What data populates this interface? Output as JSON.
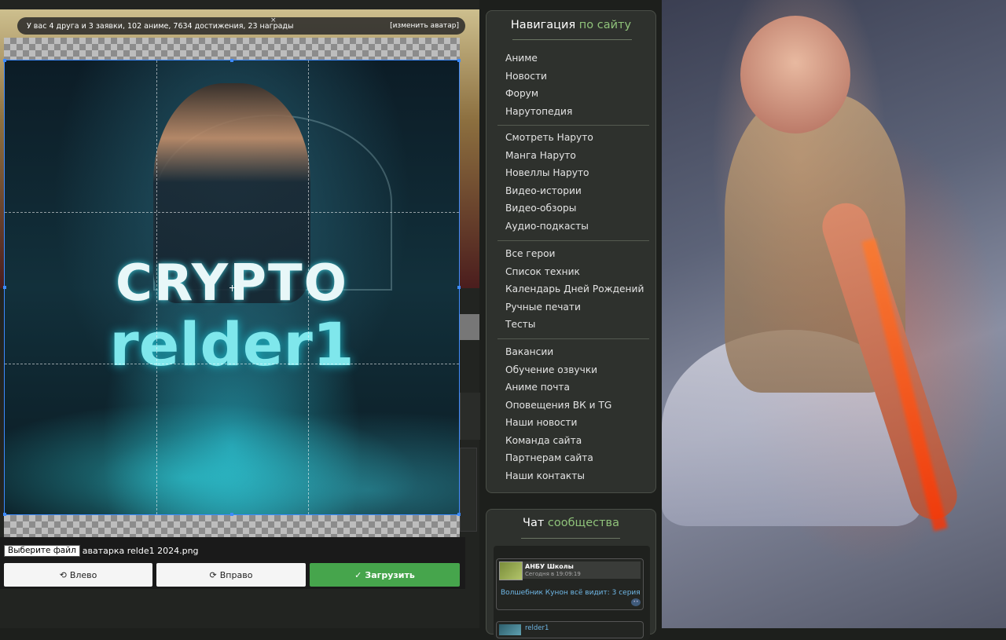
{
  "info_bar": {
    "summary": "У вас 4 друга и 3 заявки, 102 аниме, 7634 достижения, 23 награды",
    "close": "×",
    "change_avatar": "[изменить аватар]"
  },
  "cropper": {
    "image_text_top": "CRYPTO",
    "image_text_bottom": "relder1",
    "file_button": "Выберите файл",
    "file_name": "аватарка relde1 2024.png",
    "rotate_left": "Влево",
    "rotate_right": "Вправо",
    "upload": "Загрузить"
  },
  "nav": {
    "title_main": "Навигация",
    "title_accent": "по сайту",
    "groups": [
      [
        "Аниме",
        "Новости",
        "Форум",
        "Нарутопедия"
      ],
      [
        "Смотреть Наруто",
        "Манга Наруто",
        "Новеллы Наруто",
        "Видео-истории",
        "Видео-обзоры",
        "Аудио-подкасты"
      ],
      [
        "Все герои",
        "Список техник",
        "Календарь Дней Рождений",
        "Ручные печати",
        "Тесты"
      ],
      [
        "Вакансии",
        "Обучение озвучки",
        "Аниме почта",
        "Оповещения ВК и TG",
        "Наши новости",
        "Команда сайта",
        "Партнерам сайта",
        "Наши контакты"
      ]
    ]
  },
  "chat": {
    "title_main": "Чат",
    "title_accent": "сообщества",
    "messages": [
      {
        "author": "АНБУ Школы",
        "time": "Сегодня в 19:09:19",
        "text": "Волшебник Кунон всё видит: 3 серия"
      }
    ],
    "next_author": "relder1"
  },
  "colors": {
    "accent_green": "#8fc27a",
    "upload_button": "#46a54c",
    "crop_border": "#3d8bff",
    "link_blue": "#6fb7e6"
  }
}
